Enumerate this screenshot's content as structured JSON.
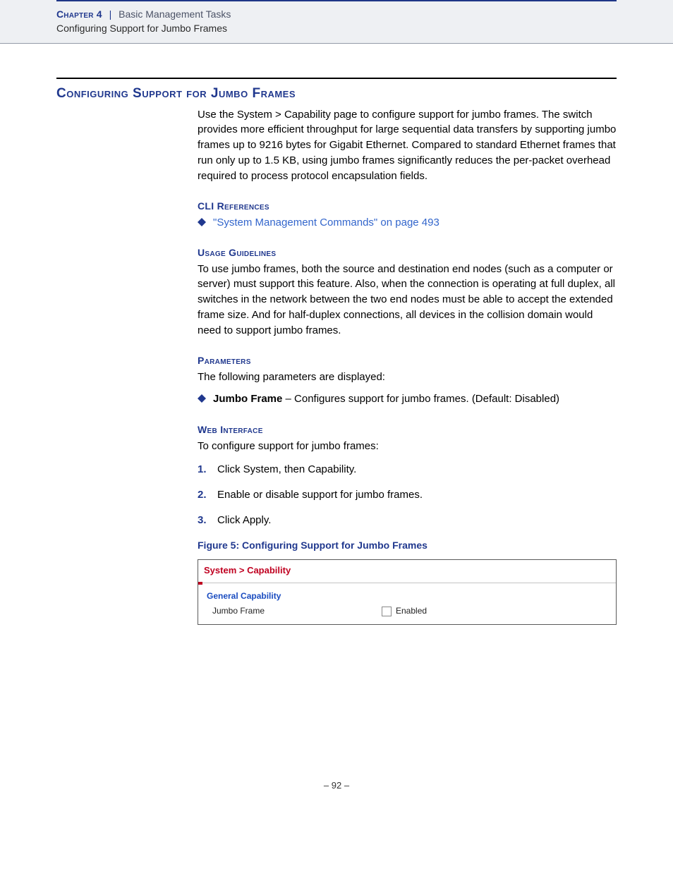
{
  "header": {
    "chapter_label": "Chapter 4",
    "separator": "|",
    "chapter_title": "Basic Management Tasks",
    "subtitle": "Configuring Support for Jumbo Frames"
  },
  "section": {
    "title": "Configuring Support for Jumbo Frames",
    "intro": "Use the System > Capability page to configure support for jumbo frames. The switch provides more efficient throughput for large sequential data transfers by supporting jumbo frames up to 9216 bytes for Gigabit Ethernet. Compared to standard Ethernet frames that run only up to 1.5 KB, using jumbo frames significantly reduces the per-packet overhead required to process protocol encapsulation fields."
  },
  "cli": {
    "heading": "CLI References",
    "link_text": "\"System Management Commands\" on page 493"
  },
  "usage": {
    "heading": "Usage Guidelines",
    "text": "To use jumbo frames, both the source and destination end nodes (such as a computer or server) must support this feature. Also, when the connection is operating at full duplex, all switches in the network between the two end nodes must be able to accept the extended frame size. And for half-duplex connections, all devices in the collision domain would need to support jumbo frames."
  },
  "parameters": {
    "heading": "Parameters",
    "intro_text": "The following parameters are displayed:",
    "item_name": "Jumbo Frame",
    "item_desc": " – Configures support for jumbo frames. (Default: Disabled)"
  },
  "web": {
    "heading": "Web Interface",
    "intro_text": "To configure support for jumbo frames:",
    "steps": [
      "Click System, then Capability.",
      "Enable or disable support for jumbo frames.",
      "Click Apply."
    ]
  },
  "figure": {
    "caption": "Figure 5:  Configuring Support for Jumbo Frames",
    "breadcrumb": "System > Capability",
    "panel_title": "General Capability",
    "row_label": "Jumbo Frame",
    "checkbox_label": "Enabled",
    "checkbox_checked": false
  },
  "footer": {
    "page_number": "–  92  –"
  }
}
